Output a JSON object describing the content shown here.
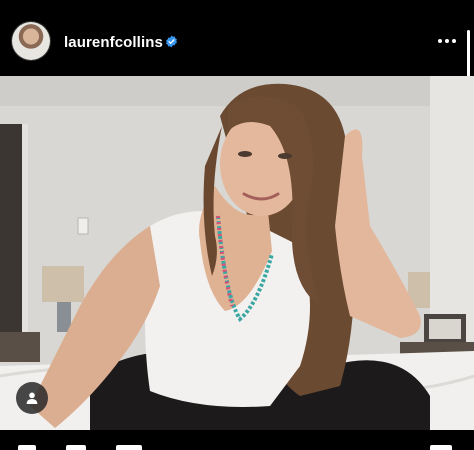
{
  "post": {
    "username": "laurenfcollins",
    "verified": true
  },
  "icons": {
    "avatar": "profile-avatar",
    "verified": "verified-badge-icon",
    "more": "more-options-icon",
    "tag": "user-tag-icon"
  },
  "colors": {
    "background": "#000000",
    "verified_blue": "#3797f0",
    "text": "#ffffff"
  }
}
